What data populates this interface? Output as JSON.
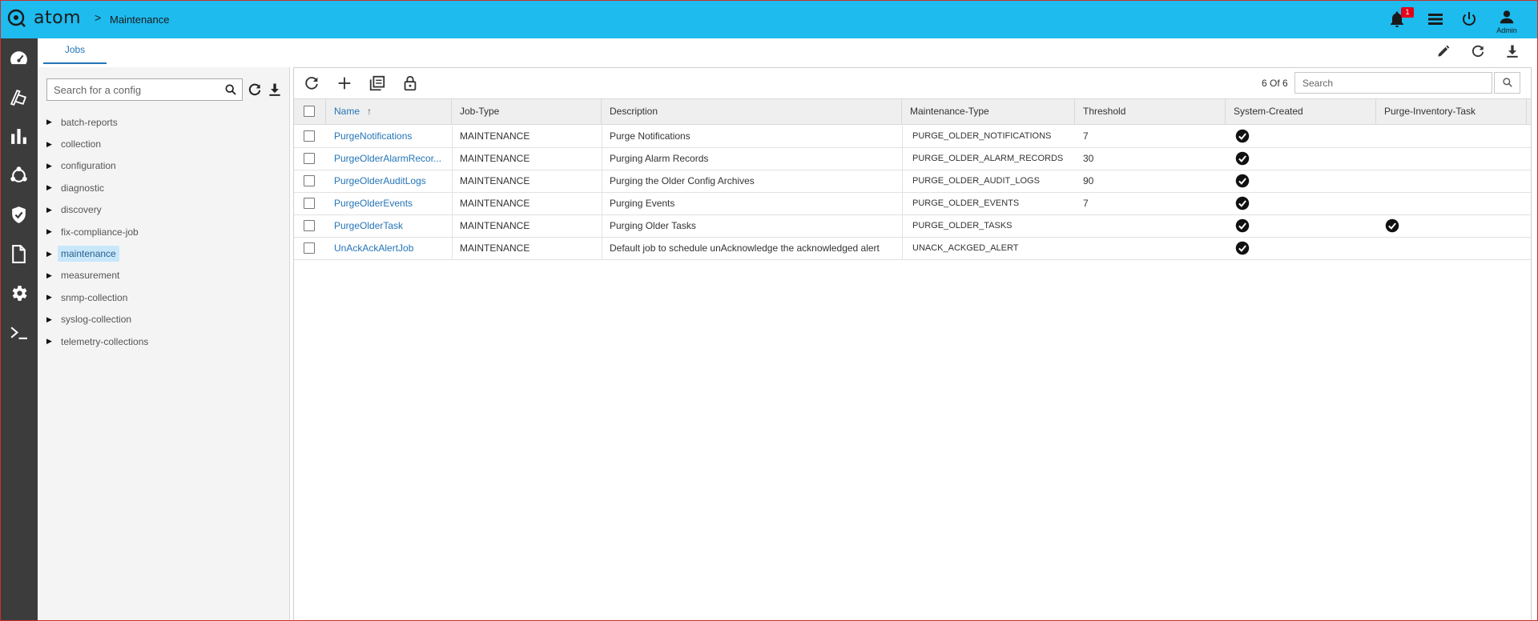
{
  "app": {
    "name": "atom",
    "breadcrumb": {
      "separator": ">",
      "current": "Maintenance"
    },
    "brand_color": "#1ebbee",
    "accent_color": "#2475b8"
  },
  "header": {
    "notifications": {
      "icon": "bell-icon",
      "count": "1"
    },
    "menu_icon": "list-icon",
    "power_icon": "power-icon",
    "user": {
      "icon": "user-icon",
      "label": "Admin"
    }
  },
  "rail": [
    {
      "icon": "dashboard-icon"
    },
    {
      "icon": "devices-icon"
    },
    {
      "icon": "bar-chart-icon"
    },
    {
      "icon": "topology-icon"
    },
    {
      "icon": "shield-check-icon"
    },
    {
      "icon": "document-icon"
    },
    {
      "icon": "gear-icon"
    },
    {
      "icon": "terminal-icon"
    }
  ],
  "tabs": [
    {
      "label": "Jobs",
      "active": true
    }
  ],
  "tab_actions": [
    "edit-icon",
    "refresh-icon",
    "download-icon"
  ],
  "config": {
    "search_placeholder": "Search for a config",
    "items": [
      {
        "label": "batch-reports",
        "selected": false
      },
      {
        "label": "collection",
        "selected": false
      },
      {
        "label": "configuration",
        "selected": false
      },
      {
        "label": "diagnostic",
        "selected": false
      },
      {
        "label": "discovery",
        "selected": false
      },
      {
        "label": "fix-compliance-job",
        "selected": false
      },
      {
        "label": "maintenance",
        "selected": true
      },
      {
        "label": "measurement",
        "selected": false
      },
      {
        "label": "snmp-collection",
        "selected": false
      },
      {
        "label": "syslog-collection",
        "selected": false
      },
      {
        "label": "telemetry-collections",
        "selected": false
      }
    ]
  },
  "grid": {
    "toolbar": [
      "refresh-icon",
      "add-icon",
      "copy-icon",
      "lock-icon"
    ],
    "count_label": "6 Of 6",
    "search_placeholder": "Search",
    "columns": [
      "Name",
      "Job-Type",
      "Description",
      "Maintenance-Type",
      "Threshold",
      "System-Created",
      "Purge-Inventory-Task"
    ],
    "sort": {
      "column": "Name",
      "direction": "ascending"
    },
    "rows": [
      {
        "name": "PurgeNotifications",
        "job_type": "MAINTENANCE",
        "description": "Purge Notifications",
        "maintenance_type": "PURGE_OLDER_NOTIFICATIONS",
        "threshold": "7",
        "system_created": true,
        "purge_inventory_task": false
      },
      {
        "name": "PurgeOlderAlarmRecor...",
        "job_type": "MAINTENANCE",
        "description": "Purging Alarm Records",
        "maintenance_type": "PURGE_OLDER_ALARM_RECORDS",
        "threshold": "30",
        "system_created": true,
        "purge_inventory_task": false
      },
      {
        "name": "PurgeOlderAuditLogs",
        "job_type": "MAINTENANCE",
        "description": "Purging the Older Config Archives",
        "maintenance_type": "PURGE_OLDER_AUDIT_LOGS",
        "threshold": "90",
        "system_created": true,
        "purge_inventory_task": false
      },
      {
        "name": "PurgeOlderEvents",
        "job_type": "MAINTENANCE",
        "description": "Purging Events",
        "maintenance_type": "PURGE_OLDER_EVENTS",
        "threshold": "7",
        "system_created": true,
        "purge_inventory_task": false
      },
      {
        "name": "PurgeOlderTask",
        "job_type": "MAINTENANCE",
        "description": "Purging Older Tasks",
        "maintenance_type": "PURGE_OLDER_TASKS",
        "threshold": "",
        "system_created": true,
        "purge_inventory_task": true
      },
      {
        "name": "UnAckAckAlertJob",
        "job_type": "MAINTENANCE",
        "description": "Default job to schedule unAcknowledge the acknowledged alert",
        "maintenance_type": "UNACK_ACKGED_ALERT",
        "threshold": "",
        "system_created": true,
        "purge_inventory_task": false
      }
    ]
  }
}
